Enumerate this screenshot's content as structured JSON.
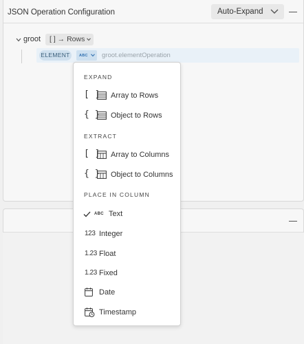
{
  "header": {
    "title": "JSON Operation Configuration",
    "auto_expand_label": "Auto-Expand"
  },
  "tree": {
    "root_label": "groot",
    "root_operation_label": "[ ] → Rows",
    "element_badge": "ELEMENT",
    "element_type": "ABC",
    "element_path": "groot.elementOperation"
  },
  "menu": {
    "expand_section": "EXPAND",
    "array_to_rows": "Array to Rows",
    "object_to_rows": "Object to Rows",
    "extract_section": "EXTRACT",
    "array_to_columns": "Array to Columns",
    "object_to_columns": "Object to Columns",
    "place_section": "PLACE IN COLUMN",
    "text": "Text",
    "integer": "Integer",
    "float": "Float",
    "fixed": "Fixed",
    "date": "Date",
    "timestamp": "Timestamp",
    "text_icon": "ABC",
    "integer_icon": "123",
    "float_icon": "1.23",
    "fixed_icon": "1.23",
    "selected": "text"
  },
  "colors": {
    "accent_blue": "#2f6fb0",
    "element_row_bg": "#e9f1f8",
    "element_badge_bg": "#cfe0ee"
  }
}
